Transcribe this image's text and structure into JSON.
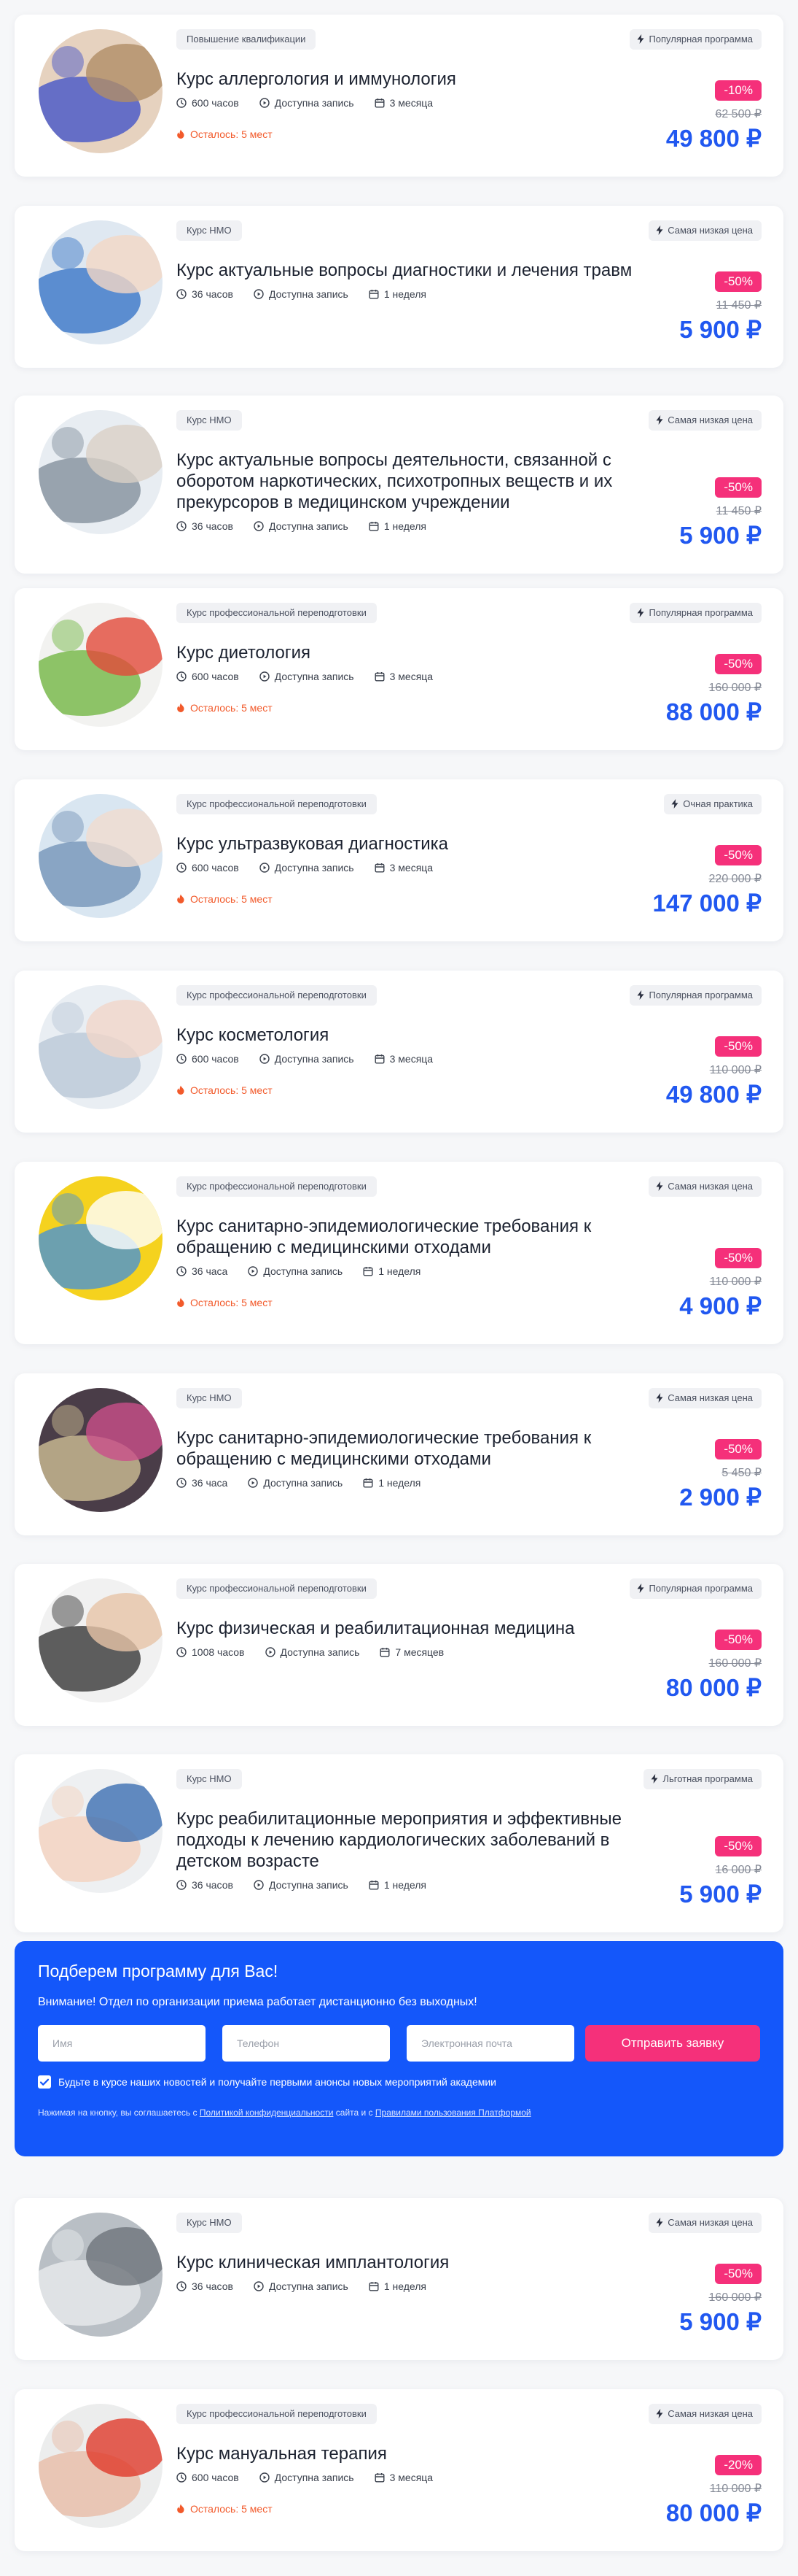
{
  "courses": [
    {
      "category": "Повышение квалификации",
      "badge": "Популярная программа",
      "title": "Курс аллергология и иммунология",
      "hours": "600 часов",
      "access": "Доступна запись",
      "duration": "3 месяца",
      "places": "Осталось: 5 мест",
      "discount": "-10%",
      "old_price": "62 500 ₽",
      "price": "49 800 ₽",
      "image": "allergy-test-photo"
    },
    {
      "category": "Курс НМО",
      "badge": "Самая низкая цена",
      "title": "Курс актуальные вопросы диагностики и лечения травм",
      "hours": "36 часов",
      "access": "Доступна запись",
      "duration": "1 неделя",
      "discount": "-50%",
      "old_price": "11 450 ₽",
      "price": "5 900 ₽",
      "image": "bandaged-arm-photo"
    },
    {
      "category": "Курс НМО",
      "badge": "Самая низкая цена",
      "title": "Курс актуальные вопросы деятельности, связанной с оборотом наркотических, психотропных веществ и их прекурсоров в медицинском учреждении",
      "hours": "36 часов",
      "access": "Доступна запись",
      "duration": "1 неделя",
      "discount": "-50%",
      "old_price": "11 450 ₽",
      "price": "5 900 ₽",
      "image": "doctor-writing-photo"
    },
    {
      "category": "Курс профессиональной переподготовки",
      "badge": "Популярная программа",
      "title": "Курс диетология",
      "hours": "600 часов",
      "access": "Доступна запись",
      "duration": "3 месяца",
      "places": "Осталось: 5 мест",
      "discount": "-50%",
      "old_price": "160 000 ₽",
      "price": "88 000 ₽",
      "image": "vegetables-photo"
    },
    {
      "category": "Курс профессиональной переподготовки",
      "badge": "Очная практика",
      "title": "Курс ультразвуковая диагностика",
      "hours": "600 часов",
      "access": "Доступна запись",
      "duration": "3 месяца",
      "places": "Осталось: 5 мест",
      "discount": "-50%",
      "old_price": "220 000 ₽",
      "price": "147 000 ₽",
      "image": "ultrasound-photo"
    },
    {
      "category": "Курс профессиональной переподготовки",
      "badge": "Популярная программа",
      "title": "Курс косметология",
      "hours": "600 часов",
      "access": "Доступна запись",
      "duration": "3 месяца",
      "places": "Осталось: 5 мест",
      "discount": "-50%",
      "old_price": "110 000 ₽",
      "price": "49 800 ₽",
      "image": "cosmetology-photo"
    },
    {
      "category": "Курс профессиональной переподготовки",
      "badge": "Самая низкая цена",
      "title": "Курс санитарно-эпидемиологические требования к обращению с медицинскими отходами",
      "hours": "36 часа",
      "access": "Доступна запись",
      "duration": "1 неделя",
      "places": "Осталось: 5 мест",
      "discount": "-50%",
      "old_price": "110 000 ₽",
      "price": "4 900 ₽",
      "image": "gloves-cleaning-photo"
    },
    {
      "category": "Курс НМО",
      "badge": "Самая низкая цена",
      "title": "Курс санитарно-эпидемиологические требования к обращению с медицинскими отходами",
      "hours": "36 часа",
      "access": "Доступна запись",
      "duration": "1 неделя",
      "discount": "-50%",
      "old_price": "5 450 ₽",
      "price": "2 900 ₽",
      "image": "petri-dish-photo"
    },
    {
      "category": "Курс профессиональной переподготовки",
      "badge": "Популярная программа",
      "title": "Курс физическая и реабилитационная медицина",
      "hours": "1008 часов",
      "access": "Доступна запись",
      "duration": "7 месяцев",
      "discount": "-50%",
      "old_price": "160 000 ₽",
      "price": "80 000 ₽",
      "image": "rehabilitation-photo"
    },
    {
      "category": "Курс НМО",
      "badge": "Льготная программа",
      "title": "Курс реабилитационные мероприятия и эффективные подходы к лечению кардиологических заболеваний в детском возрасте",
      "hours": "36 часов",
      "access": "Доступна запись",
      "duration": "1 неделя",
      "discount": "-50%",
      "old_price": "16 000 ₽",
      "price": "5 900 ₽",
      "image": "pediatric-doctor-photo"
    },
    {
      "category": "Курс НМО",
      "badge": "Самая низкая цена",
      "title": "Курс клиническая имплантология",
      "hours": "36 часов",
      "access": "Доступна запись",
      "duration": "1 неделя",
      "discount": "-50%",
      "old_price": "160 000 ₽",
      "price": "5 900 ₽",
      "image": "dental-xray-photo"
    },
    {
      "category": "Курс профессиональной переподготовки",
      "badge": "Самая низкая цена",
      "title": "Курс мануальная терапия",
      "hours": "600 часов",
      "access": "Доступна запись",
      "duration": "3 месяца",
      "places": "Осталось: 5 мест",
      "discount": "-20%",
      "old_price": "110 000 ₽",
      "price": "80 000 ₽",
      "image": "manual-therapy-photo"
    }
  ],
  "form": {
    "title": "Подберем программу для Вас!",
    "subtitle": "Внимание! Отдел по организации приема работает дистанционно без выходных!",
    "name_placeholder": "Имя",
    "phone_placeholder": "Телефон",
    "email_placeholder": "Электронная почта",
    "submit_label": "Отправить заявку",
    "newsletter_label": "Будьте в курсе наших новостей и получайте первыми анонсы новых мероприятий академии",
    "newsletter_checked": true,
    "legal_prefix": "Нажимая на кнопку, вы соглашаетесь с ",
    "privacy_link": "Политикой конфиденциальности",
    "legal_middle": " сайта и с ",
    "rules_link": "Правилами пользования Платформой"
  },
  "colors": {
    "accent": "#2158f0",
    "discount": "#f5307a",
    "form_bg": "#1457fa",
    "warning": "#f25a2b"
  }
}
